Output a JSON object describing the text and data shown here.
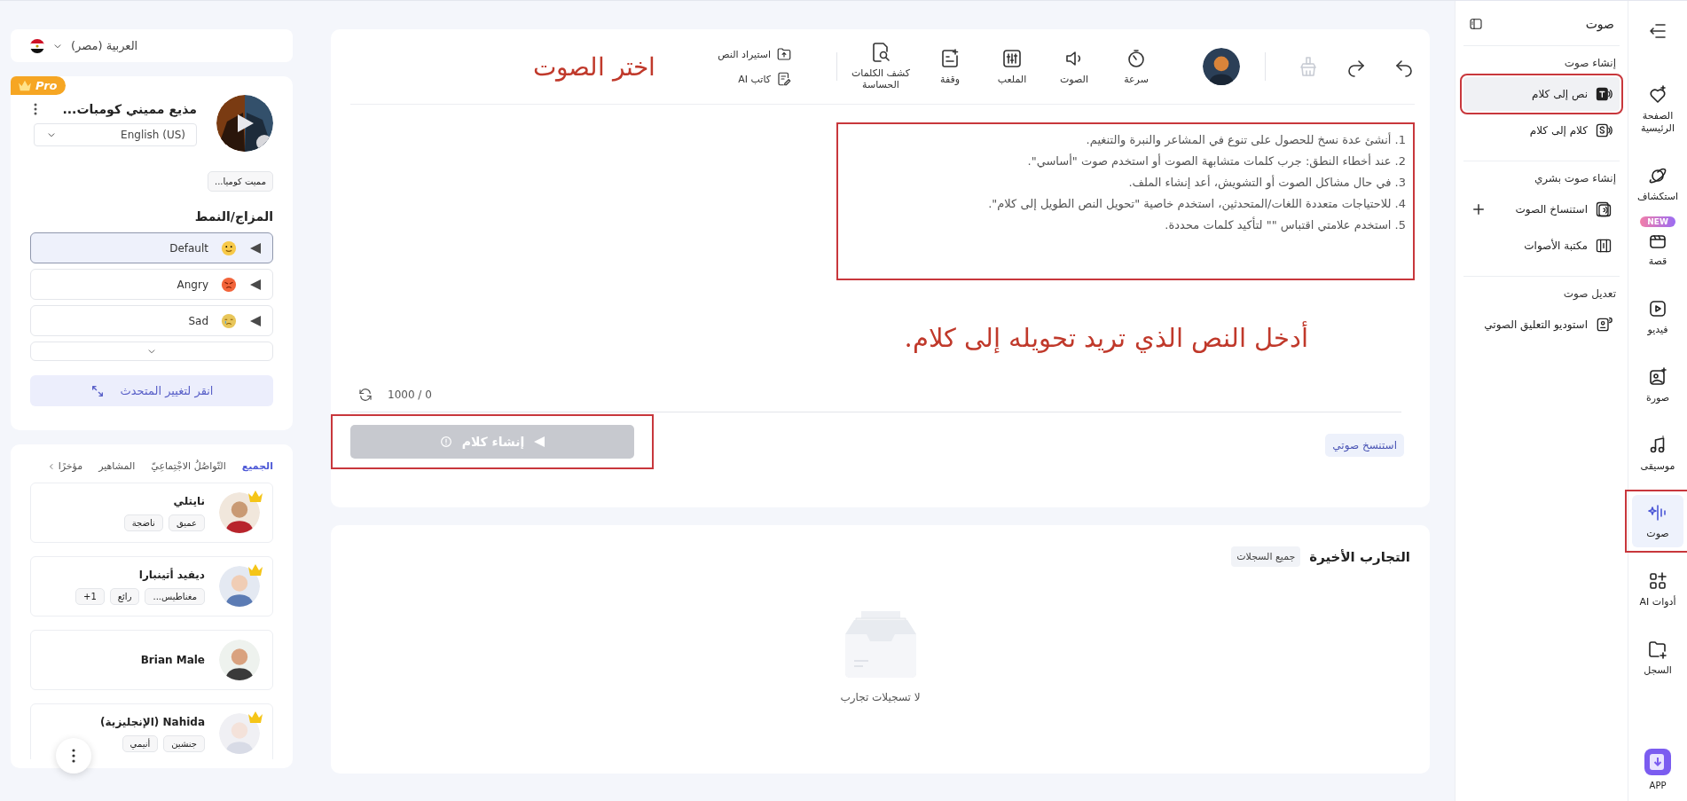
{
  "language": {
    "label": "العربية (مصر)"
  },
  "voice": {
    "badge": "Pro",
    "name": "مذيع مميني كومبات...",
    "language": "English (US)",
    "tag": "مميت كوميا...",
    "mood_title": "المزاج/النمط",
    "moods": [
      {
        "label": "Default",
        "selected": true
      },
      {
        "label": "Angry",
        "selected": false
      },
      {
        "label": "Sad",
        "selected": false
      }
    ],
    "change_button": "انقر لتغيير المتحدث"
  },
  "voice_library": {
    "tabs": [
      {
        "label": "الجميع",
        "selected": true
      },
      {
        "label": "التّواصُلُ الاجْتِماعِيّ",
        "selected": false
      },
      {
        "label": "المشاهير",
        "selected": false
      },
      {
        "label": "مؤخرًا",
        "selected": false
      }
    ],
    "voices": [
      {
        "name": "نايتلي",
        "premium": true,
        "tags": [
          "عميق",
          "ناضجة"
        ]
      },
      {
        "name": "ديفيد أتينبارا",
        "premium": true,
        "tags": [
          "مغناطيس...",
          "رائع",
          "1+"
        ]
      },
      {
        "name": "Brian Male",
        "premium": false
      },
      {
        "name": "Nahida (الإنجليزية)",
        "premium": true,
        "tags": [
          "جنشين",
          "أنيمي"
        ]
      }
    ]
  },
  "editor": {
    "clear_disabled": true,
    "tools": [
      {
        "label": "سرعة"
      },
      {
        "label": "الصوت"
      },
      {
        "label": "الملعب"
      },
      {
        "label": "وقفة"
      },
      {
        "label": "كشف الكلمات الحساسة"
      }
    ],
    "import_actions": [
      {
        "label": "استيراد النص"
      },
      {
        "label": "كاتب AI"
      }
    ],
    "voice_callout": "اختر الصوت",
    "tips_highlighted": true,
    "tips": [
      "1. أنشئ عدة نسخ للحصول على تنوع في المشاعر والنبرة والتنغيم.",
      "2. عند أخطاء النطق: جرب كلمات متشابهة الصوت أو استخدم صوت \"أساسي\".",
      "3. في حال مشاكل الصوت أو التشويش، أعد إنشاء الملف.",
      "4. للاحتياجات متعددة اللغات/المتحدثين، استخدم خاصية \"تحويل النص الطويل إلى كلام\".",
      "5. استخدم علامتي اقتباس \"\" لتأكيد كلمات محددة."
    ],
    "text_callout": "أدخل النص الذي تريد تحويله إلى كلام.",
    "counter": "0 / 1000",
    "generate_button": {
      "label": "إنشاء كلام",
      "disabled": true,
      "highlighted": true
    },
    "clone_chip": "استنسخ صوتي"
  },
  "history": {
    "title": "التجارب الأخيرة",
    "all_button": "جميع السجلات",
    "empty_text": "لا تسجيلات تجارب"
  },
  "subnav": {
    "title": "صوت",
    "sections": [
      {
        "title": "إنشاء صوت",
        "items": [
          {
            "label": "نص إلى كلام",
            "selected": true,
            "highlighted": true
          },
          {
            "label": "كلام إلى كلام",
            "selected": false,
            "highlighted": false
          }
        ]
      },
      {
        "title": "إنشاء صوت بشري",
        "items": [
          {
            "label": "استنساخ الصوت",
            "selected": false,
            "highlighted": false,
            "addable": true
          },
          {
            "label": "مكتبة الأصوات",
            "selected": false,
            "highlighted": false
          }
        ]
      },
      {
        "title": "تعديل صوت",
        "items": [
          {
            "label": "استوديو التعليق الصوتي",
            "selected": false,
            "highlighted": false
          }
        ]
      }
    ]
  },
  "nav": {
    "items": [
      {
        "label": "الصفحة الرئيسية",
        "selected": false,
        "highlighted": false
      },
      {
        "label": "استكشاف",
        "selected": false,
        "highlighted": false
      },
      {
        "label": "قصة",
        "badge": "NEW",
        "selected": false,
        "highlighted": false
      },
      {
        "label": "فيديو",
        "selected": false,
        "highlighted": false
      },
      {
        "label": "صورة",
        "selected": false,
        "highlighted": false
      },
      {
        "label": "موسيقى",
        "selected": false,
        "highlighted": false
      },
      {
        "label": "صوت",
        "selected": true,
        "highlighted": true
      },
      {
        "label": "أدوات AI",
        "selected": false,
        "highlighted": false
      },
      {
        "label": "السجل",
        "selected": false,
        "highlighted": false
      }
    ],
    "app_label": "APP"
  }
}
